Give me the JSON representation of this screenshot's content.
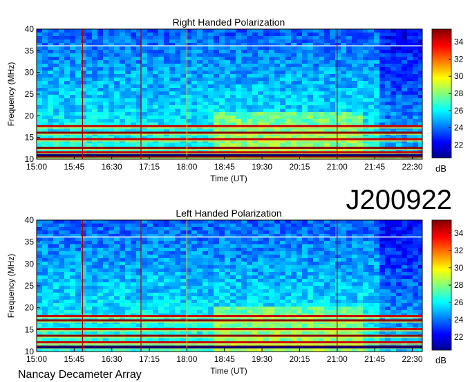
{
  "chart_data": [
    {
      "type": "heatmap",
      "title": "Right Handed Polarization",
      "xlabel": "Time (UT)",
      "ylabel": "Frequency (MHz)",
      "x_ticks": [
        "15:00",
        "15:45",
        "16:30",
        "17:15",
        "18:00",
        "18:45",
        "19:30",
        "20:15",
        "21:00",
        "21:45",
        "22:30"
      ],
      "y_ticks": [
        10,
        15,
        20,
        25,
        30,
        35,
        40
      ],
      "ylim": [
        10,
        40
      ],
      "colorbar": {
        "label": "dB",
        "ticks": [
          22,
          24,
          26,
          28,
          30,
          32,
          34
        ],
        "range": [
          20.5,
          35.5
        ]
      },
      "dominant_bands_mhz": [
        10.5,
        11.5,
        12.5,
        14.5,
        16.0,
        17.5
      ],
      "emission_arc": {
        "start_time": "16:55",
        "end_time": "17:05",
        "freq_range": [
          18,
          37
        ]
      },
      "vertical_marker_times": [
        "15:55",
        "17:05",
        "18:00",
        "21:00"
      ]
    },
    {
      "type": "heatmap",
      "title": "Left Handed Polarization",
      "xlabel": "Time (UT)",
      "ylabel": "Frequency (MHz)",
      "x_ticks": [
        "15:00",
        "15:45",
        "16:30",
        "17:15",
        "18:00",
        "18:45",
        "19:30",
        "20:15",
        "21:00",
        "21:45",
        "22:30"
      ],
      "y_ticks": [
        10,
        15,
        20,
        25,
        30,
        35,
        40
      ],
      "ylim": [
        10,
        40
      ],
      "colorbar": {
        "label": "dB",
        "ticks": [
          22,
          24,
          26,
          28,
          30,
          32,
          34
        ],
        "range": [
          20.5,
          35.5
        ]
      },
      "dominant_bands_mhz": [
        11.0,
        12.0,
        13.5,
        15.0,
        17.0,
        18.0
      ],
      "emission_arc": {
        "start_time": "16:55",
        "end_time": "17:05",
        "freq_range": [
          20,
          37
        ]
      },
      "vertical_marker_times": [
        "15:55",
        "17:05",
        "18:00",
        "21:00"
      ]
    }
  ],
  "page": {
    "date_label": "J200922",
    "footer": "Nancay Decameter Array"
  }
}
